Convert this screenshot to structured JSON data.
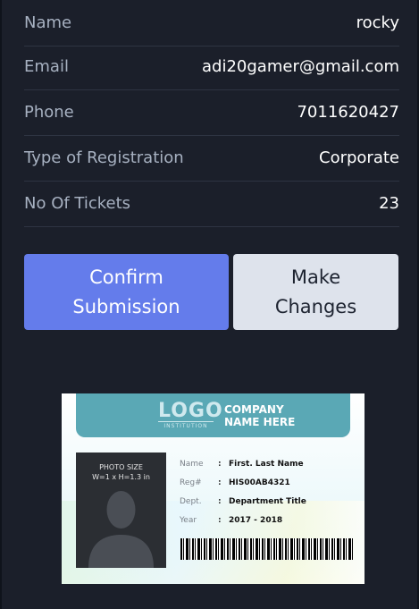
{
  "details": [
    {
      "label": "Name",
      "value": "rocky"
    },
    {
      "label": "Email",
      "value": "adi20gamer@gmail.com"
    },
    {
      "label": "Phone",
      "value": "7011620427"
    },
    {
      "label": "Type of Registration",
      "value": "Corporate"
    },
    {
      "label": "No Of Tickets",
      "value": "23"
    }
  ],
  "buttons": {
    "confirm": {
      "line1": "Confirm",
      "line2": "Submission"
    },
    "changes": {
      "line1": "Make",
      "line2": "Changes"
    }
  },
  "id_card": {
    "logo": "LOGO",
    "logo_sub": "INSTITUTION",
    "company_line1": "COMPANY",
    "company_line2": "NAME HERE",
    "photo_label_line1": "PHOTO SIZE",
    "photo_label_line2": "W=1 x H=1.3 in",
    "fields": [
      {
        "label": "Name",
        "value": "First. Last Name"
      },
      {
        "label": "Reg#",
        "value": "HIS00AB4321"
      },
      {
        "label": "Dept.",
        "value": "Department Title"
      },
      {
        "label": "Year",
        "value": "2017 - 2018"
      }
    ]
  },
  "colors": {
    "panel_bg": "#1b1f2a",
    "confirm_bg": "#647ceb",
    "changes_bg": "#dee3ec",
    "card_header": "#5aa8b5"
  }
}
